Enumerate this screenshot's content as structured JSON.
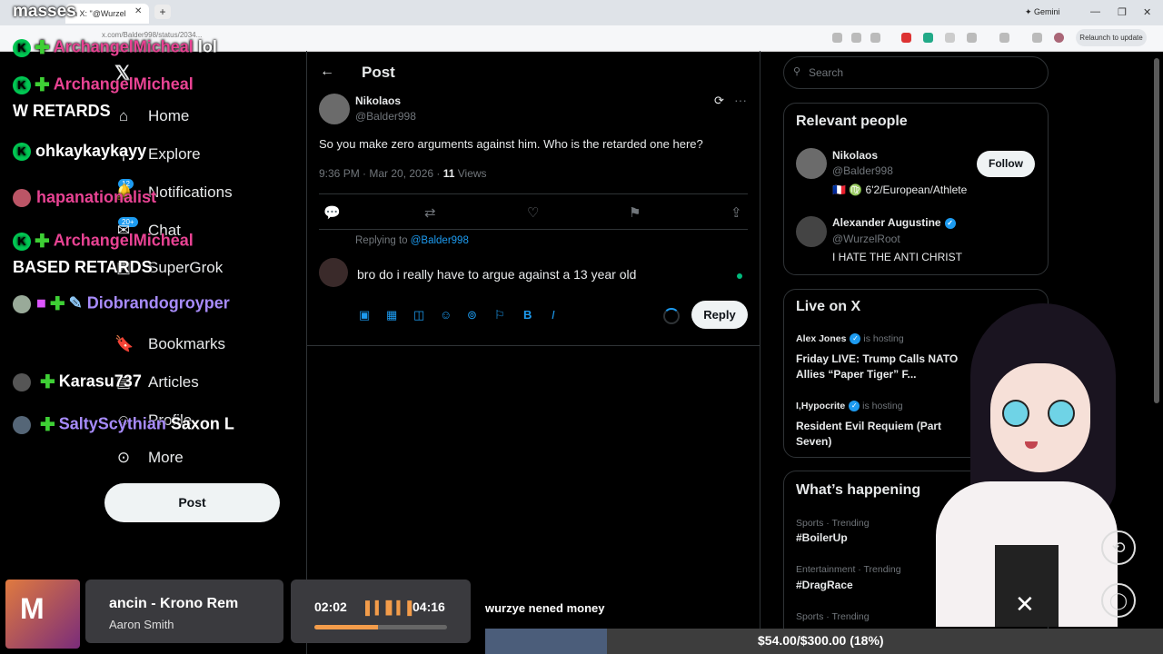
{
  "browser": {
    "stream_title": "masses",
    "tab_title": "n X: \"@Wurzel",
    "url": "x.com/Balder998/status/2034...",
    "gemini_label": "Gemini",
    "relaunch_label": "Relaunch to update"
  },
  "x_nav": {
    "items": [
      "Home",
      "Explore",
      "Notifications",
      "Chat",
      "SuperGrok",
      "Bookmarks",
      "Articles",
      "Profile",
      "More"
    ],
    "notifications_badge": "12",
    "chat_badge": "20+",
    "post_button": "Post"
  },
  "post": {
    "header": "Post",
    "author_name": "Nikolaos",
    "author_handle": "@Balder998",
    "text": "So you make zero arguments against him. Who is the retarded one here?",
    "time": "9:36 PM · Mar 20, 2026 · ",
    "views_count": "11",
    "views_label": " Views"
  },
  "reply": {
    "replying_prefix": "Replying to ",
    "replying_handle": "@Balder998",
    "text": "bro do i really have to argue against a 13 year old",
    "button": "Reply"
  },
  "search": {
    "placeholder": "Search"
  },
  "relevant_people": {
    "title": "Relevant people",
    "people": [
      {
        "name": "Nikolaos",
        "handle": "@Balder998",
        "bio": "🇫🇷 ♍ 6'2/European/Athlete",
        "action": "Follow"
      },
      {
        "name": "Alexander Augustine",
        "handle": "@WurzelRoot",
        "bio": "I HATE THE ANTI CHRIST"
      }
    ]
  },
  "live": {
    "title": "Live on X",
    "items": [
      {
        "host": "Alex Jones",
        "hosting": " is hosting",
        "title": "Friday LIVE: Trump Calls NATO Allies “Paper Tiger” F..."
      },
      {
        "host": "I,Hypocrite",
        "hosting": " is hosting",
        "title": "Resident Evil Requiem (Part Seven)"
      }
    ]
  },
  "happening": {
    "title": "What’s happening",
    "items": [
      {
        "category": "Sports · Trending",
        "tag": "#BoilerUp"
      },
      {
        "category": "Entertainment · Trending",
        "tag": "#DragRace"
      },
      {
        "category": "Sports · Trending",
        "tag": ""
      }
    ]
  },
  "stream_chat": {
    "lines": [
      {
        "user": "ArchangelMicheal",
        "message": "lol"
      },
      {
        "user": "ArchangelMicheal",
        "message": "W RETARDS"
      },
      {
        "user": "ohkaykaykayy",
        "message": ""
      },
      {
        "user": "hapanationalist",
        "message": ""
      },
      {
        "user": "ArchangelMicheal",
        "message": "BASED RETARDS"
      },
      {
        "user": "Diobrandogroyper",
        "message": ""
      },
      {
        "user": "Karasu737",
        "message": ""
      },
      {
        "user": "SaltyScythian",
        "message": "Saxon L"
      }
    ]
  },
  "now_playing": {
    "track": "ancin - Krono Rem",
    "artist": "Aaron Smith",
    "elapsed": "02:02",
    "total": "04:16",
    "progress": 0.48
  },
  "ticker": {
    "text": "wurzye nened money"
  },
  "goal": {
    "text": "$54.00/$300.00 (18%)",
    "fraction": 0.18
  },
  "colors": {
    "x_blue": "#1d9bf0",
    "chat_green": "#3ecf35",
    "chat_pink": "#e84393",
    "progress_orange": "#f39c4a"
  },
  "icons": [
    "x-logo-icon",
    "home-icon",
    "search-icon",
    "bell-icon",
    "mail-icon",
    "grok-icon",
    "bookmark-icon",
    "person-icon",
    "more-circle-icon",
    "back-arrow-icon",
    "grok-edit-icon",
    "reply-icon",
    "repost-icon",
    "like-icon",
    "bookmark-icon",
    "share-icon",
    "image-icon",
    "gif-icon",
    "grok-icon",
    "emoji-icon",
    "location-icon",
    "flag-icon",
    "bold-icon",
    "italic-icon"
  ]
}
